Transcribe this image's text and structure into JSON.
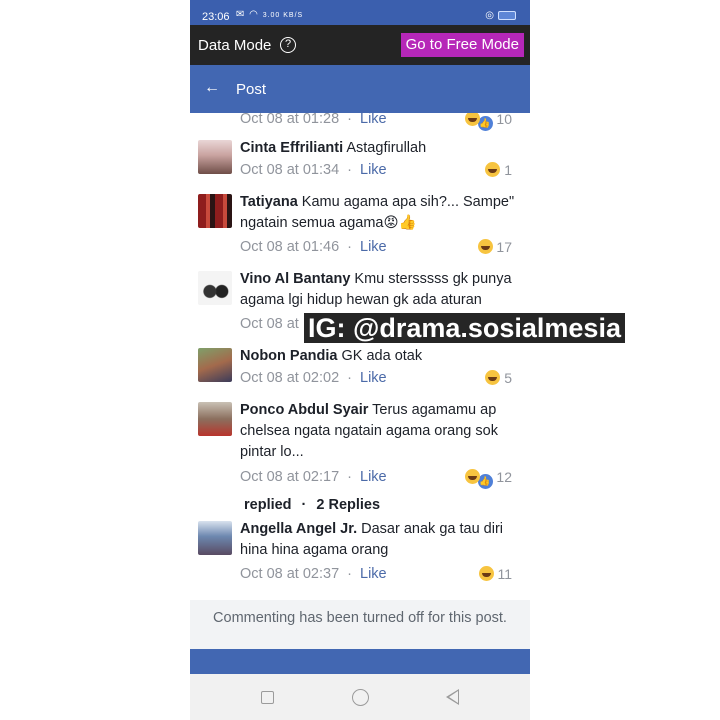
{
  "statusbar": {
    "time": "23:06",
    "network": "3.00 KB/S"
  },
  "datamode": {
    "label": "Data Mode",
    "help_icon": "?",
    "free_mode_button": "Go to Free Mode"
  },
  "nav": {
    "back_icon": "←",
    "title": "Post"
  },
  "comments": [
    {
      "author": "",
      "text": "",
      "time": "Oct 08 at 01:28",
      "like": "Like",
      "reactions": "10"
    },
    {
      "author": "Cinta Effrilianti",
      "text": "Astagfirullah",
      "time": "Oct 08 at 01:34",
      "like": "Like",
      "reactions": "1"
    },
    {
      "author": "Tatiyana",
      "text": "Kamu agama apa sih?... Sampe\" ngatain semua agama😡👍",
      "time": "Oct 08 at 01:46",
      "like": "Like",
      "reactions": "17"
    },
    {
      "author": "Vino Al Bantany",
      "text": "Kmu stersssss gk punya agama lgi hidup hewan gk ada aturan",
      "time": "Oct 08 at",
      "like": "",
      "reactions": ""
    },
    {
      "author": "Nobon Pandia",
      "text": "GK ada otak",
      "time": "Oct 08 at 02:02",
      "like": "Like",
      "reactions": "5"
    },
    {
      "author": "Ponco Abdul Syair",
      "text": "Terus agamamu ap chelsea ngata ngatain agama orang sok pintar lo...",
      "time": "Oct 08 at 02:17",
      "like": "Like",
      "reactions": "12"
    },
    {
      "author": "Angella Angel Jr.",
      "text": "Dasar anak ga tau diri hina hina agama orang",
      "time": "Oct 08 at 02:37",
      "like": "Like",
      "reactions": "11"
    }
  ],
  "replies": {
    "prefix": "replied",
    "count": "2 Replies"
  },
  "closed_notice": "Commenting has been turned off for this post.",
  "watermark": "IG: @drama.sosialmesia",
  "colors": {
    "facebook_blue": "#4267b2",
    "free_mode_purple": "#b627b8",
    "like_blue": "#4b6aa8"
  }
}
